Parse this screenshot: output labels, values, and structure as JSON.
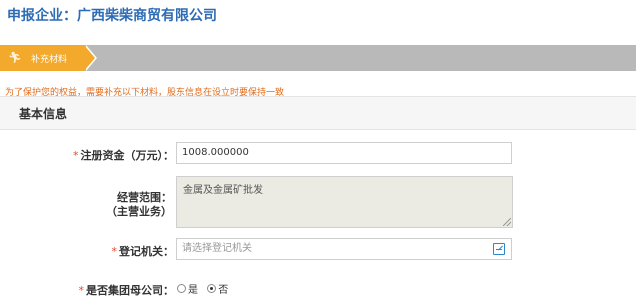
{
  "header": {
    "company": "申报企业：广西柴柴商贸有限公司"
  },
  "steps": [
    {
      "label": "补充材料",
      "icon": "runner-icon",
      "active": true
    }
  ],
  "notice": "为了保护您的权益，需要补充以下材料，股东信息在设立时要保持一致",
  "section": {
    "title": "基本信息"
  },
  "form": {
    "required_mark": "*",
    "registered_capital": {
      "label": "注册资金（万元）：",
      "value": "1008.000000"
    },
    "business_scope": {
      "label_line1": "经营范围：",
      "label_line2": "（主营业务）",
      "value": "金属及金属矿批发"
    },
    "registration_authority": {
      "label": "登记机关：",
      "placeholder": "请选择登记机关",
      "icon": "edit-picker-icon"
    },
    "parent_company": {
      "label": "是否集团母公司：",
      "options": [
        "是",
        "否"
      ],
      "selected": "否"
    }
  },
  "colors": {
    "header_blue": "#2d6cb5",
    "step_active": "#f3a92b",
    "step_bar": "#b9b9b9",
    "notice_orange": "#e06b1c",
    "required_red": "#e8452c"
  }
}
